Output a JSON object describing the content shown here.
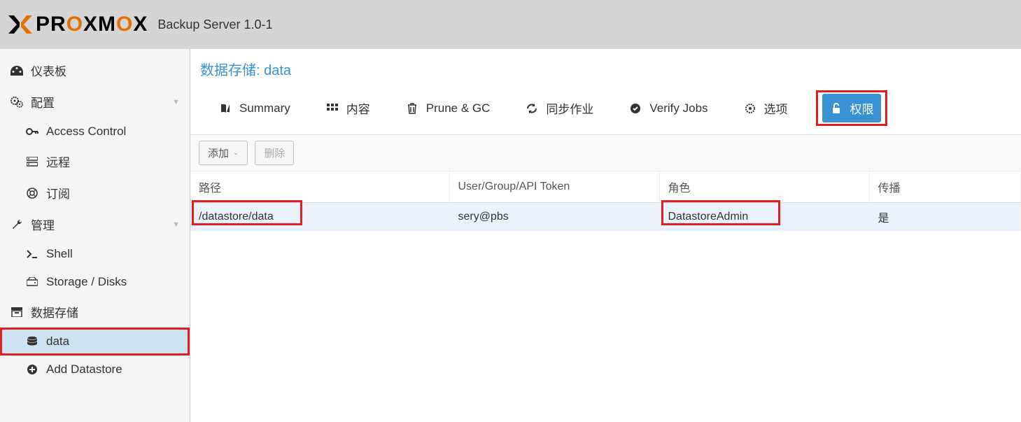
{
  "header": {
    "logo_prefix": "PR",
    "logo_mid": "O",
    "logo_suffix": "XM",
    "logo_mid2": "O",
    "logo_end": "X",
    "subtitle": "Backup Server 1.0-1"
  },
  "sidebar": {
    "dashboard": "仪表板",
    "config": "配置",
    "access_control": "Access Control",
    "remote": "远程",
    "subscription": "订阅",
    "admin": "管理",
    "shell": "Shell",
    "storage_disks": "Storage / Disks",
    "datastore": "数据存储",
    "data": "data",
    "add_datastore": "Add Datastore"
  },
  "content": {
    "title_prefix": "数据存储: ",
    "title_name": "data",
    "tabs": {
      "summary": "Summary",
      "content": "内容",
      "prune": "Prune & GC",
      "sync": "同步作业",
      "verify": "Verify Jobs",
      "options": "选项",
      "permissions": "权限"
    },
    "toolbar": {
      "add": "添加",
      "remove": "删除"
    },
    "table": {
      "headers": {
        "path": "路径",
        "user": "User/Group/API Token",
        "role": "角色",
        "propagate": "传播"
      },
      "rows": [
        {
          "path": "/datastore/data",
          "user": "sery@pbs",
          "role": "DatastoreAdmin",
          "propagate": "是"
        }
      ]
    }
  }
}
